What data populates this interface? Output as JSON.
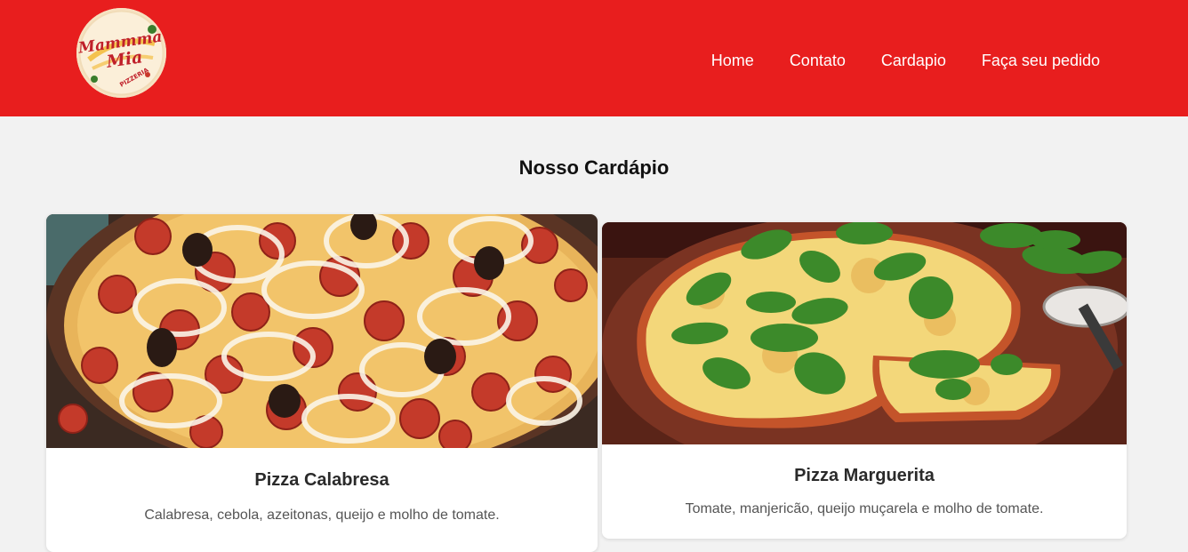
{
  "header": {
    "logo": {
      "text_line1": "Mammma",
      "text_line2": "Mia",
      "text_arc": "PIZZERIA"
    },
    "nav": [
      "Home",
      "Contato",
      "Cardapio",
      "Faça seu pedido"
    ]
  },
  "main": {
    "title": "Nosso Cardápio",
    "cards": [
      {
        "title": "Pizza Calabresa",
        "description": "Calabresa, cebola, azeitonas, queijo e molho de tomate."
      },
      {
        "title": "Pizza Marguerita",
        "description": "Tomate, manjericão, queijo muçarela e molho de tomate."
      }
    ]
  },
  "colors": {
    "header_bg": "#e81e1e",
    "page_bg": "#f2f2f2"
  }
}
